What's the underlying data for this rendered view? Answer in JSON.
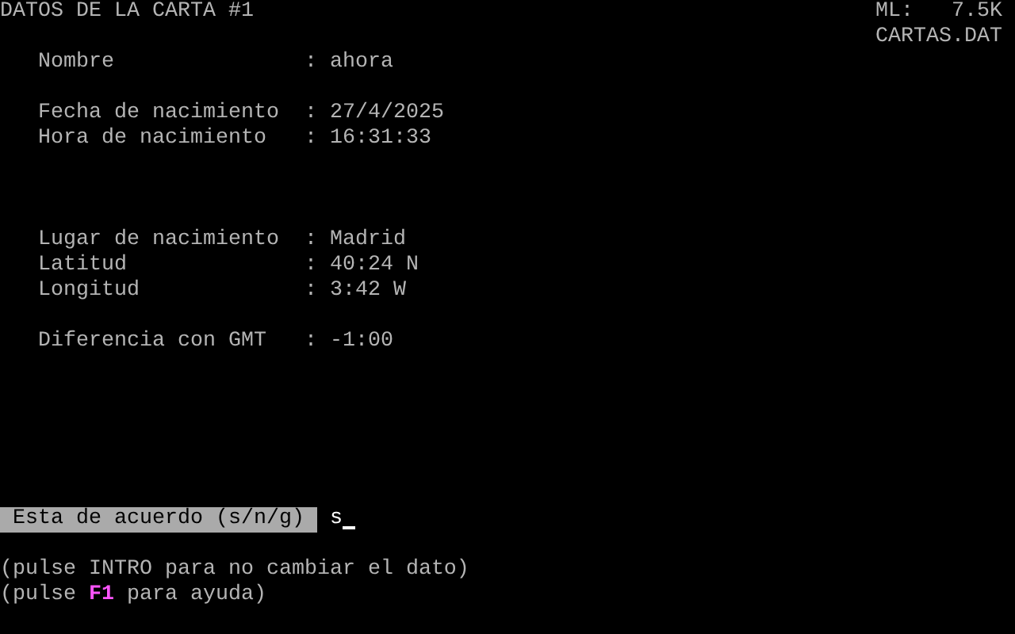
{
  "title": "DATOS DE LA CARTA #1",
  "memory": {
    "label": "ML:",
    "value": "7.5K"
  },
  "file_name": "CARTAS.DAT",
  "field_groups": [
    [
      {
        "label": "Nombre",
        "value": "ahora"
      }
    ],
    [
      {
        "label": "Fecha de nacimiento",
        "value": "27/4/2025"
      },
      {
        "label": "Hora de nacimiento",
        "value": "16:31:33"
      }
    ],
    [
      {
        "label": "Lugar de nacimiento",
        "value": "Madrid"
      },
      {
        "label": "Latitud",
        "value": "40:24 N"
      },
      {
        "label": "Longitud",
        "value": "3:42 W"
      }
    ],
    [
      {
        "label": "Diferencia con GMT",
        "value": "-1:00"
      }
    ]
  ],
  "separator": ":",
  "prompt": {
    "label": "Esta de acuerdo (s/n/g)",
    "value": "s"
  },
  "help_lines": [
    [
      {
        "text": "(pulse INTRO para no cambiar el dato)",
        "highlight": false
      }
    ],
    [
      {
        "text": "(pulse ",
        "highlight": false
      },
      {
        "text": "F1",
        "highlight": true
      },
      {
        "text": " para ayuda)",
        "highlight": false
      }
    ]
  ]
}
